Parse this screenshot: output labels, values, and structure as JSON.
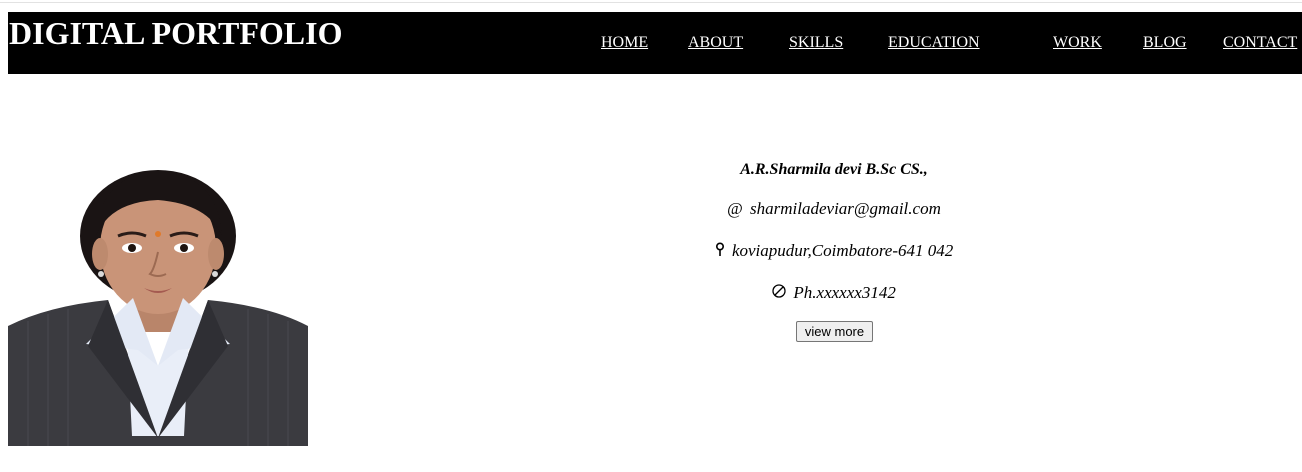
{
  "header": {
    "brand": "DIGITAL PORTFOLIO",
    "nav": [
      {
        "label": "HOME"
      },
      {
        "label": "ABOUT"
      },
      {
        "label": "SKILLS"
      },
      {
        "label": "EDUCATION"
      },
      {
        "label": "WORK"
      },
      {
        "label": "BLOG"
      },
      {
        "label": "CONTACT"
      }
    ]
  },
  "profile": {
    "photo_icon": "profile-photo",
    "name": "A.R.Sharmila devi B.Sc CS.,",
    "email_icon": "@",
    "email": "sharmiladeviar@gmail.com",
    "location_icon": "location-pin-icon",
    "address": "koviapudur,Coimbatore-641 042",
    "phone_icon": "phone-icon",
    "phone": "Ph.xxxxxx3142",
    "view_more_label": "view more"
  },
  "colors": {
    "navbar_bg": "#000000",
    "nav_text": "#ffffff",
    "page_bg": "#ffffff"
  }
}
